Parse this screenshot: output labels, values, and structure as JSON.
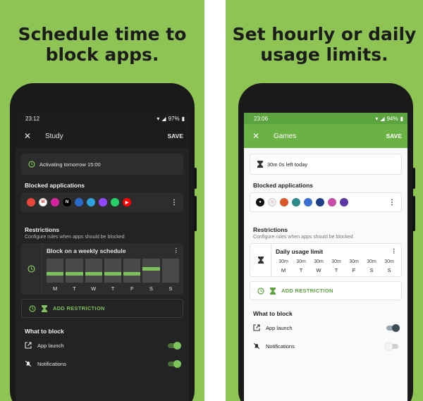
{
  "left": {
    "headline": "Schedule time to\nblock apps.",
    "status": {
      "time": "23:12",
      "battery": "97%"
    },
    "appbar": {
      "title": "Study",
      "save": "SAVE"
    },
    "info_text": "Activating tomorrow 15:00",
    "blocked_title": "Blocked applications",
    "apps": [
      {
        "name": "chrome-icon",
        "color": "#e8453c",
        "glyph": ""
      },
      {
        "name": "gmail-icon",
        "color": "#ffffff",
        "glyph": "M"
      },
      {
        "name": "instagram-icon",
        "color": "#d6249f",
        "glyph": ""
      },
      {
        "name": "netflix-icon",
        "color": "#000000",
        "glyph": "N"
      },
      {
        "name": "app-icon",
        "color": "#2a6ccc",
        "glyph": ""
      },
      {
        "name": "telegram-icon",
        "color": "#2aa3de",
        "glyph": ""
      },
      {
        "name": "twitch-icon",
        "color": "#9146ff",
        "glyph": ""
      },
      {
        "name": "whatsapp-icon",
        "color": "#25d366",
        "glyph": ""
      },
      {
        "name": "youtube-icon",
        "color": "#ff0000",
        "glyph": "▶"
      }
    ],
    "restrictions_title": "Restrictions",
    "restrictions_sub": "Configure rules when apps should be blocked",
    "schedule_title": "Block on a weekly schedule",
    "days": [
      {
        "letter": "M",
        "fill": 0.55
      },
      {
        "letter": "T",
        "fill": 0.55
      },
      {
        "letter": "W",
        "fill": 0.55
      },
      {
        "letter": "T",
        "fill": 0.55
      },
      {
        "letter": "F",
        "fill": 0.55
      },
      {
        "letter": "S",
        "fill": 0.35
      },
      {
        "letter": "S",
        "fill": null
      }
    ],
    "add_restriction": "ADD RESTRICTION",
    "what_to_block": "What to block",
    "app_launch": "App launch",
    "notifications": "Notifications"
  },
  "right": {
    "headline": "Set hourly or daily\nusage limits.",
    "status": {
      "time": "23:06",
      "battery": "94%"
    },
    "appbar": {
      "title": "Games",
      "save": "SAVE"
    },
    "info_text": "30m 0s left today",
    "blocked_title": "Blocked applications",
    "apps": [
      {
        "name": "game-icon-1",
        "color": "#111111",
        "glyph": "●"
      },
      {
        "name": "game-icon-2",
        "color": "#f0f0f0",
        "glyph": "○"
      },
      {
        "name": "game-icon-3",
        "color": "#d9582b",
        "glyph": ""
      },
      {
        "name": "game-icon-4",
        "color": "#2e8b8b",
        "glyph": ""
      },
      {
        "name": "game-icon-5",
        "color": "#3b6fd1",
        "glyph": ""
      },
      {
        "name": "game-icon-6",
        "color": "#1d3f86",
        "glyph": ""
      },
      {
        "name": "game-icon-7",
        "color": "#c94fa8",
        "glyph": ""
      },
      {
        "name": "game-icon-8",
        "color": "#5a3aa8",
        "glyph": ""
      }
    ],
    "restrictions_title": "Restrictions",
    "restrictions_sub": "Configure rules when apps should be blocked",
    "limit_title": "Daily usage limit",
    "limits": [
      {
        "value": "30m",
        "letter": "M"
      },
      {
        "value": "30m",
        "letter": "T"
      },
      {
        "value": "30m",
        "letter": "W"
      },
      {
        "value": "30m",
        "letter": "T"
      },
      {
        "value": "30m",
        "letter": "F"
      },
      {
        "value": "30m",
        "letter": "S"
      },
      {
        "value": "30m",
        "letter": "S"
      }
    ],
    "add_restriction": "ADD RESTRICTION",
    "what_to_block": "What to block",
    "app_launch": "App launch",
    "notifications": "Notifications"
  }
}
